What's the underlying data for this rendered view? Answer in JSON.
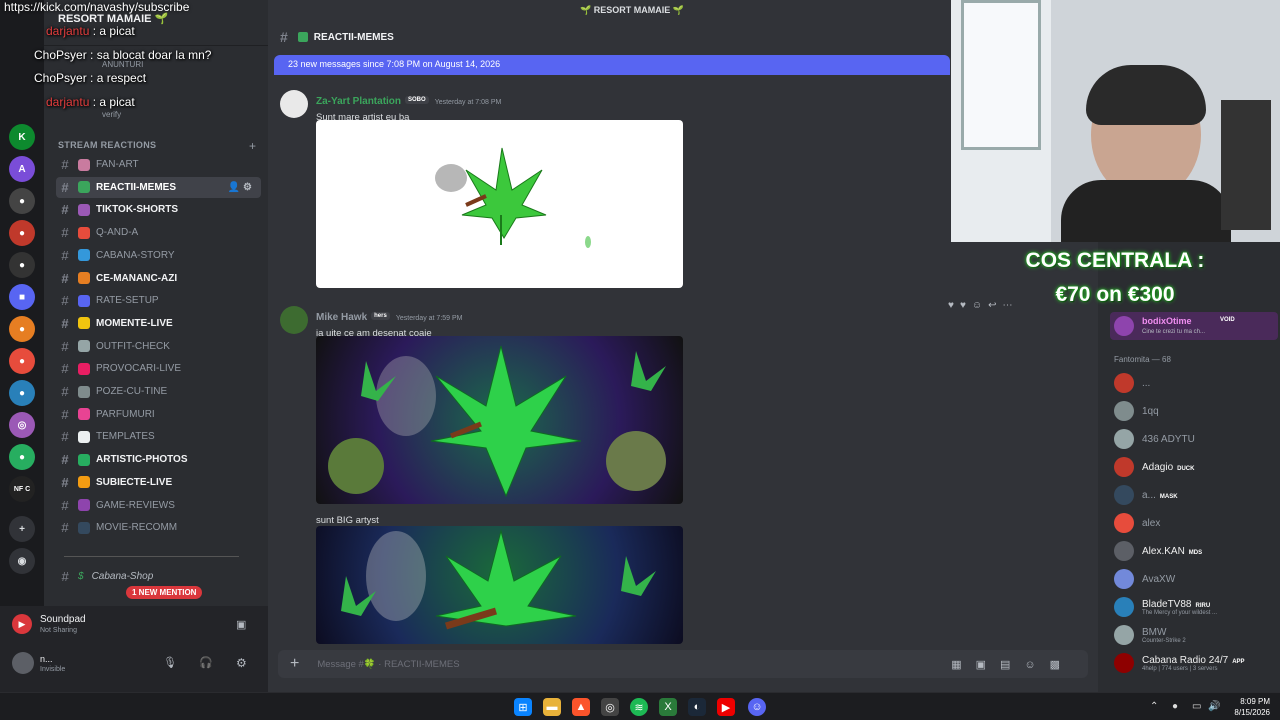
{
  "overlay": {
    "kick_url": "https://kick.com/navashy/subscribe",
    "chat": [
      {
        "user": "darjantu",
        "text": ": a picat"
      },
      {
        "user": "ChoPsyer",
        "text": ": sa blocat doar la mn?"
      },
      {
        "user": "ChoPsyer",
        "text": ": a respect"
      },
      {
        "user": "darjantu",
        "text": ": a picat"
      }
    ]
  },
  "window_title": "🌱 RESORT MAMAIE 🌱",
  "server": {
    "name": "RESORT MAMAIE 🌱",
    "header_line": "ANUNTURI",
    "verify": "verify",
    "category": "STREAM REACTIONS",
    "channels": [
      {
        "name": "FAN-ART",
        "unread": false
      },
      {
        "name": "REACTII-MEMES",
        "unread": true,
        "active": true
      },
      {
        "name": "TIKTOK-SHORTS",
        "unread": true
      },
      {
        "name": "Q-AND-A",
        "unread": false
      },
      {
        "name": "CABANA-STORY",
        "unread": false
      },
      {
        "name": "CE-MANANC-AZI",
        "unread": true
      },
      {
        "name": "RATE-SETUP",
        "unread": false
      },
      {
        "name": "MOMENTE-LIVE",
        "unread": true
      },
      {
        "name": "OUTFIT-CHECK",
        "unread": false
      },
      {
        "name": "PROVOCARI-LIVE",
        "unread": false
      },
      {
        "name": "POZE-CU-TINE",
        "unread": false
      },
      {
        "name": "PARFUMURI",
        "unread": false
      },
      {
        "name": "TEMPLATES",
        "unread": false
      },
      {
        "name": "ARTISTIC-PHOTOS",
        "unread": true
      },
      {
        "name": "SUBIECTE-LIVE",
        "unread": true
      },
      {
        "name": "GAME-REVIEWS",
        "unread": false
      },
      {
        "name": "MOVIE-RECOMM",
        "unread": false
      }
    ],
    "cabana_shop": "Cabana-Shop",
    "new_mention": "1 NEW MENTION"
  },
  "user_panel": {
    "activity_title": "Soundpad",
    "activity_sub": "Not Sharing",
    "username": "n...",
    "status": "Invisible"
  },
  "channel": {
    "title": "REACTII-MEMES",
    "new_messages_bar": "23 new messages since 7:08 PM on August 14, 2026",
    "placeholder": "Message #🍀 · REACTII-MEMES"
  },
  "messages": [
    {
      "author": "Za-Yart Plantation",
      "tag": "SOBO",
      "time": "Yesterday at 7:08 PM",
      "text": "Sunt mare artist eu ba",
      "color": "#3ba55c"
    },
    {
      "author": "Mike Hawk",
      "tag": "hers",
      "time": "Yesterday at 7:59 PM",
      "text": "ia uite ce am desenat coaie",
      "color": "#949ba4"
    },
    {
      "author": "",
      "tag": "",
      "time": "",
      "text": "sunt BIG artyst",
      "color": "#949ba4"
    }
  ],
  "stream": {
    "promo_line1": "COS CENTRALA :",
    "promo_line2": "€70 on €300"
  },
  "members": {
    "top": {
      "name": "bodixOtime",
      "tag": "VOID",
      "sub": "Cine te crezi tu ma ch..."
    },
    "group": "Fantomita — 68",
    "list": [
      {
        "name": "...",
        "tag": "",
        "sub": ""
      },
      {
        "name": "1qq",
        "tag": "",
        "sub": ""
      },
      {
        "name": "436 ADYTU",
        "tag": "",
        "sub": ""
      },
      {
        "name": "Adagio",
        "tag": "DUCK",
        "sub": ""
      },
      {
        "name": "a...",
        "tag": "MASK",
        "sub": ""
      },
      {
        "name": "alex",
        "tag": "",
        "sub": ""
      },
      {
        "name": "Alex.KAN",
        "tag": "MDS",
        "sub": ""
      },
      {
        "name": "AvaXW",
        "tag": "",
        "sub": ""
      },
      {
        "name": "BladeTV88",
        "tag": "RIRU",
        "sub": "The Mercy of your wildest ..."
      },
      {
        "name": "BMW",
        "tag": "",
        "sub": "Counter-Strike 2"
      },
      {
        "name": "Cabana Radio 24/7",
        "tag": "APP",
        "sub": "4help | 774 users | 3 servers"
      }
    ]
  },
  "clock": {
    "time": "8:09 PM",
    "date": "8/15/2026"
  },
  "colors": {
    "accent": "#5865f2",
    "mention": "#da373c",
    "promo": "#2fd12f"
  }
}
